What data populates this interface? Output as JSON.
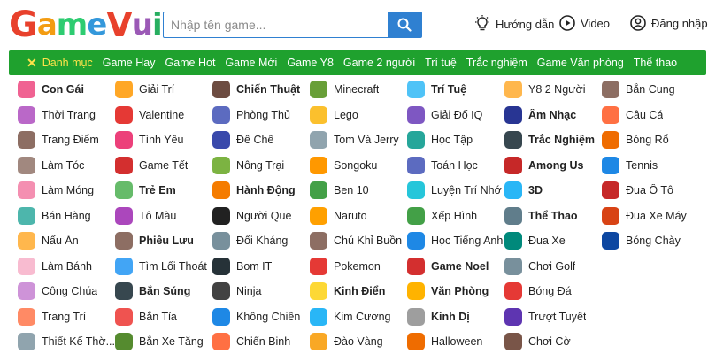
{
  "header": {
    "logo_text": "GameVui",
    "search": {
      "placeholder": "Nhập tên game...",
      "value": ""
    },
    "nav": {
      "guide": "Hướng dẫn",
      "video": "Video",
      "login": "Đăng nhập"
    }
  },
  "category_bar": {
    "active": "Danh mục",
    "items": [
      "Game Hay",
      "Game Hot",
      "Game Mới",
      "Game Y8",
      "Game 2 người",
      "Trí tuệ",
      "Trắc nghiệm",
      "Game Văn phòng",
      "Thể thao"
    ]
  },
  "colors": {
    "brand_green": "#1fa12e",
    "active_yellow": "#ffe34a",
    "search_blue": "#2f80d1"
  },
  "categories": {
    "col1": [
      {
        "label": "Con Gái",
        "bold": true,
        "icon": "girl-face-icon",
        "color": "#f06292"
      },
      {
        "label": "Thời Trang",
        "bold": false,
        "icon": "fashion-icon",
        "color": "#ba68c8"
      },
      {
        "label": "Trang Điểm",
        "bold": false,
        "icon": "makeup-icon",
        "color": "#8d6e63"
      },
      {
        "label": "Làm Tóc",
        "bold": false,
        "icon": "hair-icon",
        "color": "#a1887f"
      },
      {
        "label": "Làm Móng",
        "bold": false,
        "icon": "nail-icon",
        "color": "#f48fb1"
      },
      {
        "label": "Bán Hàng",
        "bold": false,
        "icon": "shop-icon",
        "color": "#4db6ac"
      },
      {
        "label": "Nấu Ăn",
        "bold": false,
        "icon": "chef-icon",
        "color": "#ffb74d"
      },
      {
        "label": "Làm Bánh",
        "bold": false,
        "icon": "cake-icon",
        "color": "#f8bbd0"
      },
      {
        "label": "Công Chúa",
        "bold": false,
        "icon": "princess-icon",
        "color": "#ce93d8"
      },
      {
        "label": "Trang Trí",
        "bold": false,
        "icon": "decoration-icon",
        "color": "#ff8a65"
      },
      {
        "label": "Thiết Kế Thờ...",
        "bold": false,
        "icon": "design-icon",
        "color": "#90a4ae"
      }
    ],
    "col2": [
      {
        "label": "Giải Trí",
        "bold": false,
        "icon": "entertainment-icon",
        "color": "#ffa726"
      },
      {
        "label": "Valentine",
        "bold": false,
        "icon": "valentine-icon",
        "color": "#e53935"
      },
      {
        "label": "Tình Yêu",
        "bold": false,
        "icon": "heart-icon",
        "color": "#ec407a"
      },
      {
        "label": "Game Tết",
        "bold": false,
        "icon": "tet-icon",
        "color": "#d32f2f"
      },
      {
        "label": "Trẻ Em",
        "bold": true,
        "icon": "kid-icon",
        "color": "#66bb6a"
      },
      {
        "label": "Tô Màu",
        "bold": false,
        "icon": "coloring-icon",
        "color": "#ab47bc"
      },
      {
        "label": "Phiêu Lưu",
        "bold": true,
        "icon": "adventure-icon",
        "color": "#8d6e63"
      },
      {
        "label": "Tìm Lối Thoát",
        "bold": false,
        "icon": "exit-icon",
        "color": "#42a5f5"
      },
      {
        "label": "Bắn Súng",
        "bold": true,
        "icon": "gun-icon",
        "color": "#37474f"
      },
      {
        "label": "Bắn Tỉa",
        "bold": false,
        "icon": "target-icon",
        "color": "#ef5350"
      },
      {
        "label": "Bắn Xe Tăng",
        "bold": false,
        "icon": "tank-icon",
        "color": "#558b2f"
      }
    ],
    "col3": [
      {
        "label": "Chiến Thuật",
        "bold": true,
        "icon": "strategy-icon",
        "color": "#6d4c41"
      },
      {
        "label": "Phòng Thủ",
        "bold": false,
        "icon": "shield-icon",
        "color": "#5c6bc0"
      },
      {
        "label": "Đế Chế",
        "bold": false,
        "icon": "empire-icon",
        "color": "#3949ab"
      },
      {
        "label": "Nông Trại",
        "bold": false,
        "icon": "farm-icon",
        "color": "#7cb342"
      },
      {
        "label": "Hành Động",
        "bold": true,
        "icon": "action-icon",
        "color": "#f57c00"
      },
      {
        "label": "Người Que",
        "bold": false,
        "icon": "stickman-icon",
        "color": "#212121"
      },
      {
        "label": "Đối Kháng",
        "bold": false,
        "icon": "swords-icon",
        "color": "#78909c"
      },
      {
        "label": "Bom IT",
        "bold": false,
        "icon": "bomb-icon",
        "color": "#263238"
      },
      {
        "label": "Ninja",
        "bold": false,
        "icon": "ninja-icon",
        "color": "#424242"
      },
      {
        "label": "Không Chiến",
        "bold": false,
        "icon": "plane-icon",
        "color": "#1e88e5"
      },
      {
        "label": "Chiến Binh",
        "bold": false,
        "icon": "warrior-icon",
        "color": "#ff7043"
      }
    ],
    "col4": [
      {
        "label": "Minecraft",
        "bold": false,
        "icon": "minecraft-icon",
        "color": "#689f38"
      },
      {
        "label": "Lego",
        "bold": false,
        "icon": "lego-icon",
        "color": "#fbc02d"
      },
      {
        "label": "Tom Và Jerry",
        "bold": false,
        "icon": "tom-jerry-icon",
        "color": "#90a4ae"
      },
      {
        "label": "Songoku",
        "bold": false,
        "icon": "songoku-icon",
        "color": "#ff9800"
      },
      {
        "label": "Ben 10",
        "bold": false,
        "icon": "ben10-icon",
        "color": "#43a047"
      },
      {
        "label": "Naruto",
        "bold": false,
        "icon": "naruto-icon",
        "color": "#ffa000"
      },
      {
        "label": "Chú Khỉ Buồn",
        "bold": false,
        "icon": "monkey-icon",
        "color": "#8d6e63"
      },
      {
        "label": "Pokemon",
        "bold": false,
        "icon": "pokeball-icon",
        "color": "#e53935"
      },
      {
        "label": "Kinh Điển",
        "bold": true,
        "icon": "classic-icon",
        "color": "#fdd835"
      },
      {
        "label": "Kim Cương",
        "bold": false,
        "icon": "diamond-icon",
        "color": "#29b6f6"
      },
      {
        "label": "Đào Vàng",
        "bold": false,
        "icon": "gold-mining-icon",
        "color": "#f9a825"
      }
    ],
    "col5": [
      {
        "label": "Trí Tuệ",
        "bold": true,
        "icon": "brain-icon",
        "color": "#4fc3f7"
      },
      {
        "label": "Giải Đố IQ",
        "bold": false,
        "icon": "puzzle-icon",
        "color": "#7e57c2"
      },
      {
        "label": "Học Tập",
        "bold": false,
        "icon": "study-icon",
        "color": "#26a69a"
      },
      {
        "label": "Toán Học",
        "bold": false,
        "icon": "math-icon",
        "color": "#5c6bc0"
      },
      {
        "label": "Luyện Trí Nhớ",
        "bold": false,
        "icon": "memory-icon",
        "color": "#26c6da"
      },
      {
        "label": "Xếp Hình",
        "bold": false,
        "icon": "tetris-icon",
        "color": "#43a047"
      },
      {
        "label": "Học Tiếng Anh",
        "bold": false,
        "icon": "english-icon",
        "color": "#1e88e5"
      },
      {
        "label": "Game Noel",
        "bold": true,
        "icon": "santa-icon",
        "color": "#d32f2f"
      },
      {
        "label": "Văn Phòng",
        "bold": true,
        "icon": "folder-icon",
        "color": "#ffb300"
      },
      {
        "label": "Kinh Dị",
        "bold": true,
        "icon": "ghost-icon",
        "color": "#9e9e9e"
      },
      {
        "label": "Halloween",
        "bold": false,
        "icon": "pumpkin-icon",
        "color": "#ef6c00"
      }
    ],
    "col6": [
      {
        "label": "Y8 2 Người",
        "bold": false,
        "icon": "two-players-icon",
        "color": "#ffb74d"
      },
      {
        "label": "Âm Nhạc",
        "bold": true,
        "icon": "music-icon",
        "color": "#283593"
      },
      {
        "label": "Trắc Nghiệm",
        "bold": true,
        "icon": "quiz-icon",
        "color": "#37474f"
      },
      {
        "label": "Among Us",
        "bold": true,
        "icon": "among-us-icon",
        "color": "#c62828"
      },
      {
        "label": "3D",
        "bold": true,
        "icon": "3d-icon",
        "color": "#29b6f6"
      },
      {
        "label": "Thể Thao",
        "bold": true,
        "icon": "sports-icon",
        "color": "#607d8b"
      },
      {
        "label": "Đua Xe",
        "bold": false,
        "icon": "race-car-icon",
        "color": "#00897b"
      },
      {
        "label": "Chơi Golf",
        "bold": false,
        "icon": "golf-icon",
        "color": "#78909c"
      },
      {
        "label": "Bóng Đá",
        "bold": false,
        "icon": "football-icon",
        "color": "#e53935"
      },
      {
        "label": "Trượt Tuyết",
        "bold": false,
        "icon": "ski-icon",
        "color": "#5e35b1"
      },
      {
        "label": "Chơi Cờ",
        "bold": false,
        "icon": "chess-icon",
        "color": "#795548"
      }
    ],
    "col7": [
      {
        "label": "Bắn Cung",
        "bold": false,
        "icon": "archery-icon",
        "color": "#8d6e63"
      },
      {
        "label": "Câu Cá",
        "bold": false,
        "icon": "fishing-icon",
        "color": "#ff7043"
      },
      {
        "label": "Bóng Rổ",
        "bold": false,
        "icon": "basketball-icon",
        "color": "#ef6c00"
      },
      {
        "label": "Tennis",
        "bold": false,
        "icon": "tennis-icon",
        "color": "#1e88e5"
      },
      {
        "label": "Đua Ô Tô",
        "bold": false,
        "icon": "car-icon",
        "color": "#c62828"
      },
      {
        "label": "Đua Xe Máy",
        "bold": false,
        "icon": "motorbike-icon",
        "color": "#d84315"
      },
      {
        "label": "Bóng Chày",
        "bold": false,
        "icon": "baseball-icon",
        "color": "#0d47a1"
      }
    ]
  }
}
